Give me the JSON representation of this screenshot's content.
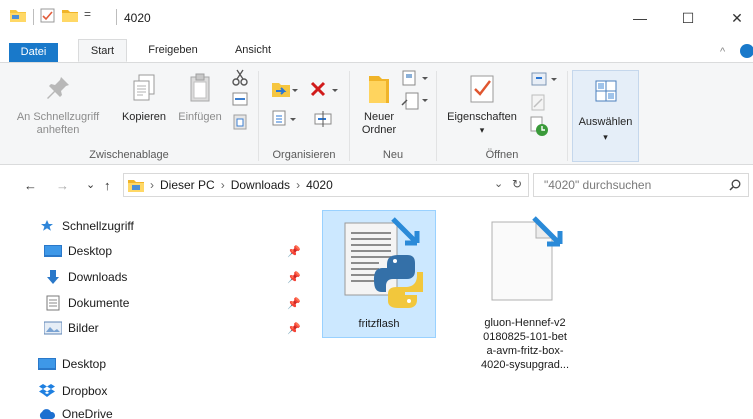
{
  "window": {
    "title": "4020",
    "qa_dropdown": "=",
    "minimize": "—",
    "maximize": "☐",
    "close": "✕"
  },
  "ribbon_tabs": [
    {
      "label": "Datei"
    },
    {
      "label": "Start"
    },
    {
      "label": "Freigeben"
    },
    {
      "label": "Ansicht"
    }
  ],
  "ribbon": {
    "pin_quick_access": "An Schnellzugriff anheften",
    "pin_line1": "An Schnellzugriff",
    "pin_line2": "anheften",
    "copy": "Kopieren",
    "paste": "Einfügen",
    "group_clipboard": "Zwischenablage",
    "group_organize": "Organisieren",
    "new_folder_line1": "Neuer",
    "new_folder_line2": "Ordner",
    "group_new": "Neu",
    "properties": "Eigenschaften",
    "group_open": "Öffnen",
    "select": "Auswählen",
    "dropdown_arrow": "▾",
    "collapse": "^"
  },
  "address_bar": {
    "breadcrumbs": [
      "Dieser PC",
      "Downloads",
      "4020"
    ],
    "separator": "›",
    "search_placeholder": "\"4020\" durchsuchen",
    "back": "←",
    "forward": "→",
    "recent": "⌄",
    "up": "↑",
    "history": "⌄",
    "refresh": "↻"
  },
  "nav_pane": [
    {
      "label": "Schnellzugriff",
      "icon": "star-icon",
      "pinned": false
    },
    {
      "label": "Desktop",
      "icon": "desktop-icon",
      "pinned": true
    },
    {
      "label": "Downloads",
      "icon": "download-icon",
      "pinned": true
    },
    {
      "label": "Dokumente",
      "icon": "document-icon",
      "pinned": true
    },
    {
      "label": "Bilder",
      "icon": "pictures-icon",
      "pinned": true
    },
    {
      "label": "Desktop",
      "icon": "desktop-icon",
      "pinned": false
    },
    {
      "label": "Dropbox",
      "icon": "dropbox-icon",
      "pinned": false
    },
    {
      "label": "OneDrive",
      "icon": "onedrive-icon",
      "pinned": false
    }
  ],
  "files": [
    {
      "name": "fritzflash",
      "selected": true
    },
    {
      "name_lines": [
        "gluon-Hennef-v2",
        "0180825-101-bet",
        "a-avm-fritz-box-",
        "4020-sysupgrad..."
      ],
      "selected": false
    }
  ],
  "colors": {
    "accent": "#1979ca",
    "selection": "#cce8ff",
    "ribbon_bg": "#f5f6f7"
  }
}
